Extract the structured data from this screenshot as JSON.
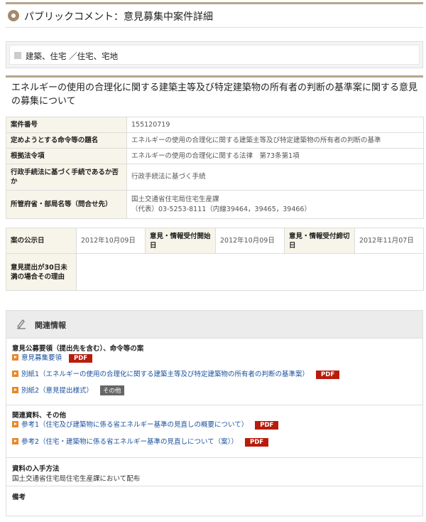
{
  "header": {
    "title": "パブリックコメント：意見募集中案件詳細",
    "icon": "circle-bullet-icon"
  },
  "category": "建築、住宅 ／住宅、宅地",
  "case_title": "エネルギーの使用の合理化に関する建築主等及び特定建築物の所有者の判断の基準案に関する意見の募集について",
  "info_table": [
    {
      "label": "案件番号",
      "value": "155120719"
    },
    {
      "label": "定めようとする命令等の題名",
      "value": "エネルギーの使用の合理化に関する建築主等及び特定建築物の所有者の判断の基準"
    },
    {
      "label": "根拠法令項",
      "value": "エネルギーの使用の合理化に関する法律　第73条第1項"
    },
    {
      "label": "行政手続法に基づく手続であるか否か",
      "value": "行政手続法に基づく手続"
    },
    {
      "label": "所管府省・部局名等（問合せ先）",
      "value": "国土交通省住宅局住宅生産課",
      "value2": "（代表）03-5253-8111（内線39464，39465，39466）"
    }
  ],
  "date_table": {
    "publish_label": "案の公示日",
    "publish_date": "2012年10月09日",
    "start_label": "意見・情報受付開始日",
    "start_date": "2012年10月09日",
    "end_label": "意見・情報受付締切日",
    "end_date": "2012年11月07日",
    "short_label": "意見提出が30日未満の場合その理由",
    "short_value": ""
  },
  "related": {
    "heading": "関連情報",
    "sections": [
      {
        "title": "意見公募要領（提出先を含む）、命令等の案",
        "links": [
          {
            "label": "意見募集要領",
            "badge": "PDF"
          },
          {
            "label": "別紙1（エネルギーの使用の合理化に関する建築主等及び特定建築物の所有者の判断の基準案）",
            "badge": "PDF"
          },
          {
            "label": "別紙2（意見提出様式）",
            "badge": "その他"
          }
        ]
      },
      {
        "title": "関連資料、その他",
        "links": [
          {
            "label": "参考1（住宅及び建築物に係る省エネルギー基準の見直しの概要について）",
            "badge": "PDF"
          },
          {
            "label": "参考2（住宅・建築物に係る省エネルギー基準の見直しについて（案））",
            "badge": "PDF"
          }
        ]
      }
    ],
    "obtain_title": "資料の入手方法",
    "obtain_text": "国土交通省住宅局住宅生産課において配布",
    "remarks_title": "備考",
    "remarks_text": ""
  },
  "colors": {
    "accent": "#b8a68c",
    "label_bg": "#f7f4e9",
    "pdf": "#b81c0d",
    "link": "#1a4f9a"
  }
}
